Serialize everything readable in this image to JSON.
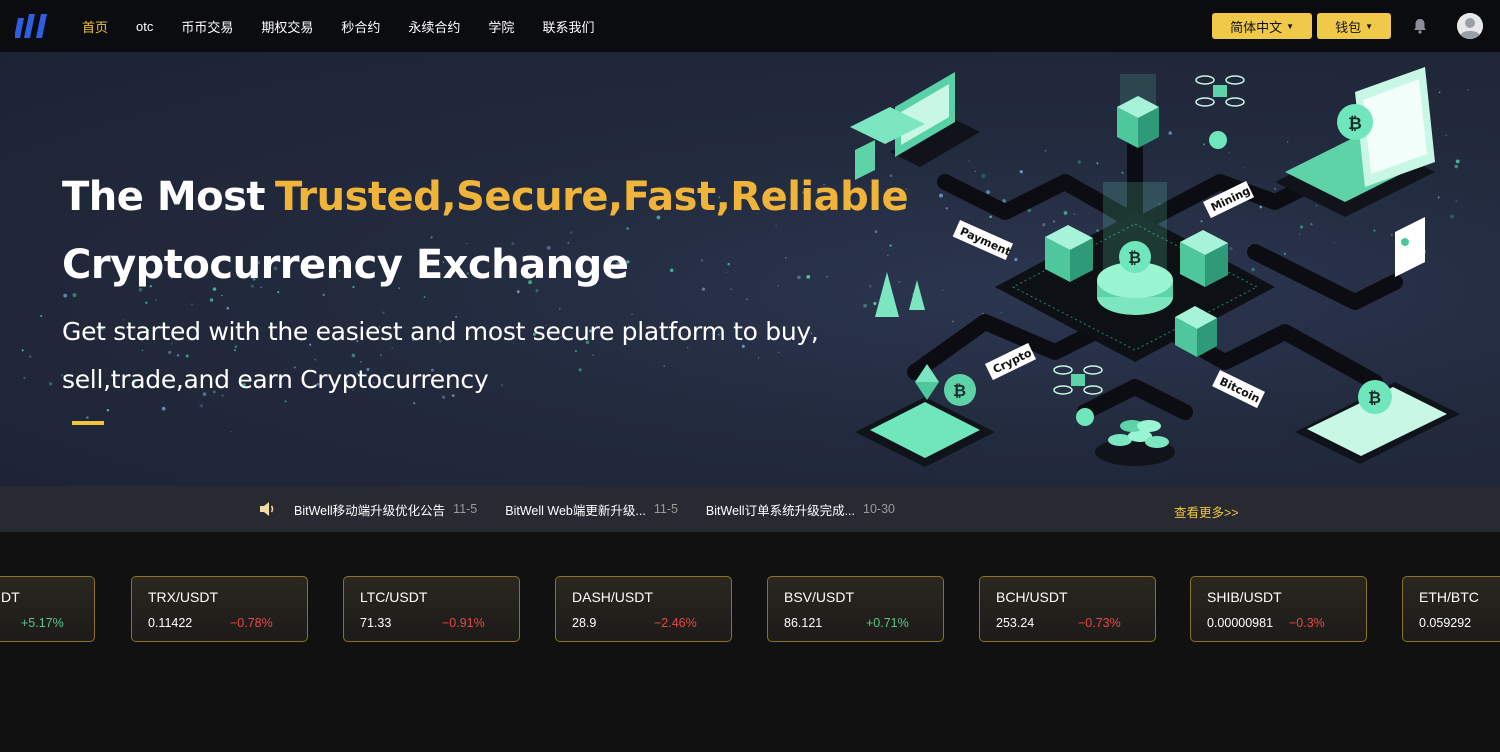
{
  "nav": {
    "items": [
      {
        "label": "首页",
        "active": true
      },
      {
        "label": "otc",
        "active": false
      },
      {
        "label": "币币交易",
        "active": false
      },
      {
        "label": "期权交易",
        "active": false
      },
      {
        "label": "秒合约",
        "active": false
      },
      {
        "label": "永续合约",
        "active": false
      },
      {
        "label": "学院",
        "active": false
      },
      {
        "label": "联系我们",
        "active": false
      }
    ],
    "language_label": "简体中文",
    "wallet_label": "钱包",
    "icons": {
      "logo": "logo-icon",
      "bell": "bell-icon",
      "avatar": "avatar-icon",
      "caret": "caret-down-icon"
    }
  },
  "hero": {
    "title_prefix": "The Most",
    "title_highlight": "Trusted,Secure,Fast,Reliable",
    "title_line2": "Cryptocurrency Exchange",
    "subtitle": "Get started with the easiest and most secure platform to buy, sell,trade,and earn Cryptocurrency",
    "illustration_labels": [
      "Payment",
      "Mining",
      "Crypto",
      "Bitcoin"
    ]
  },
  "notices": {
    "items": [
      {
        "title": "BitWell移动端升级优化公告",
        "date": "11-5"
      },
      {
        "title": "BitWell Web端更新升级...",
        "date": "11-5"
      },
      {
        "title": "BitWell订单系统升级完成...",
        "date": "10-30"
      }
    ],
    "more_label": "查看更多>>"
  },
  "tickers": [
    {
      "pair": "ONE/USDT",
      "pair_visible": "DT",
      "price": "",
      "change": "+5.17%",
      "direction": "up"
    },
    {
      "pair": "TRX/USDT",
      "price": "0.11422",
      "change": "−0.78%",
      "direction": "down"
    },
    {
      "pair": "LTC/USDT",
      "price": "71.33",
      "change": "−0.91%",
      "direction": "down"
    },
    {
      "pair": "DASH/USDT",
      "price": "28.9",
      "change": "−2.46%",
      "direction": "down"
    },
    {
      "pair": "BSV/USDT",
      "price": "86.121",
      "change": "+0.71%",
      "direction": "up"
    },
    {
      "pair": "BCH/USDT",
      "price": "253.24",
      "change": "−0.73%",
      "direction": "down"
    },
    {
      "pair": "SHIB/USDT",
      "price": "0.00000981",
      "change": "−0.3%",
      "direction": "down"
    },
    {
      "pair": "ETH/BTC",
      "price": "0.059292",
      "change": "",
      "direction": "up"
    }
  ],
  "colors": {
    "accent": "#f0c43b",
    "up": "#5cc78b",
    "down": "#e84848",
    "hero_bg": "#222a3d"
  }
}
